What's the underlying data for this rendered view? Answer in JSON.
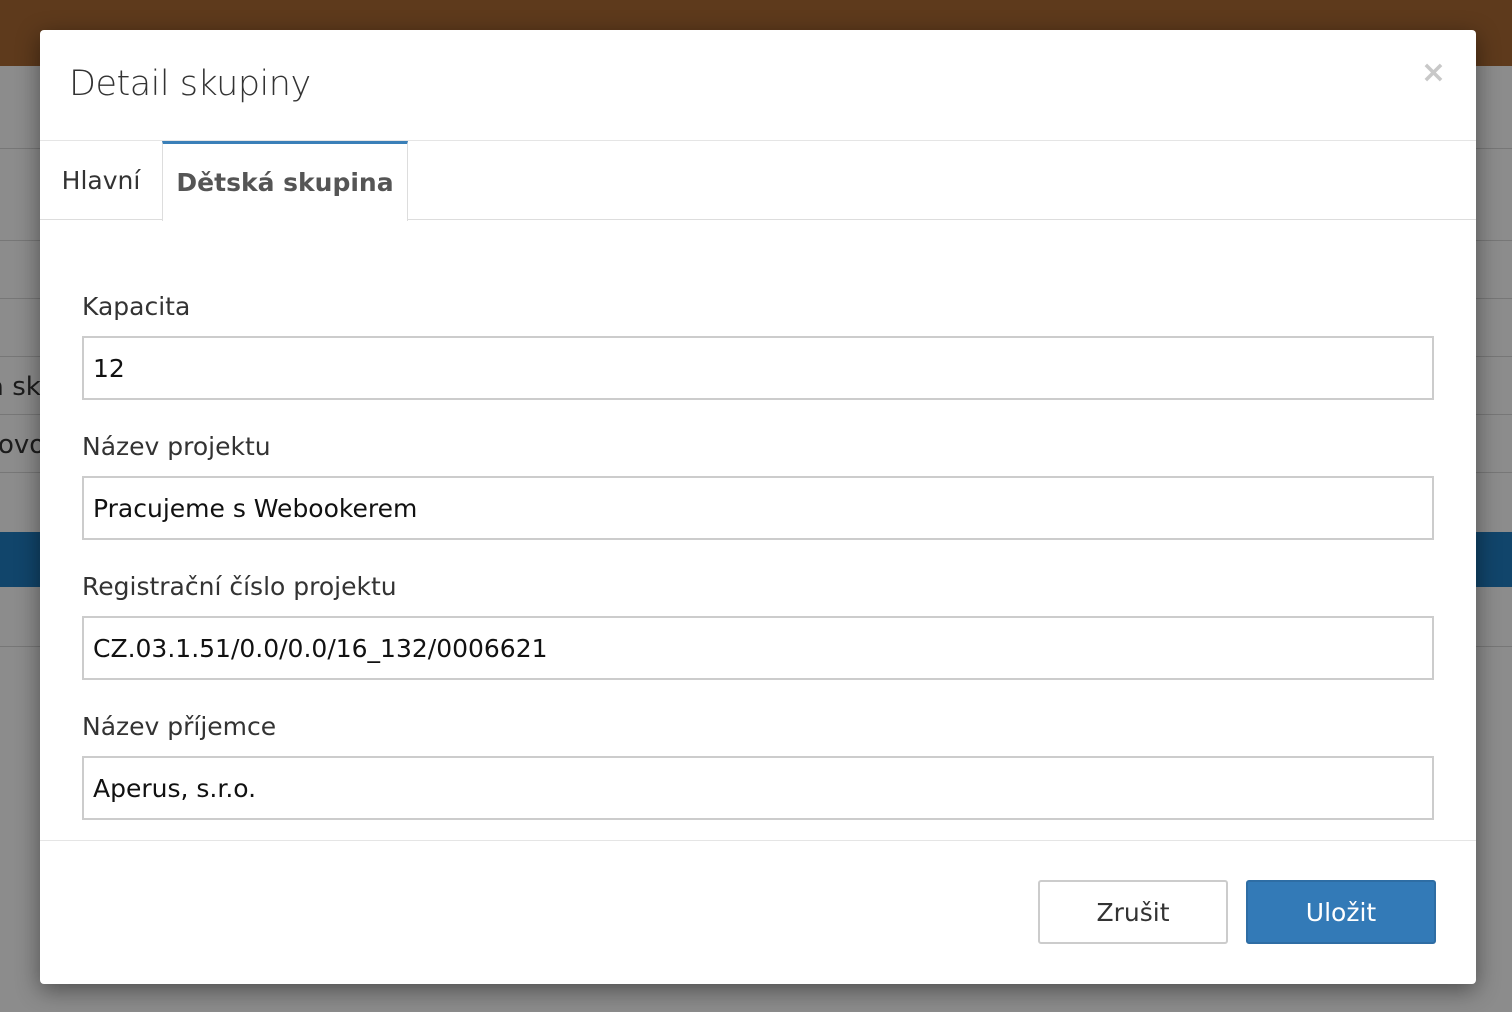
{
  "background": {
    "snippets": [
      "a sku",
      "ovo"
    ]
  },
  "modal": {
    "title": "Detail skupiny",
    "close_label": "×",
    "tabs": [
      {
        "label": "Hlavní",
        "active": false
      },
      {
        "label": "Dětská skupina",
        "active": true
      }
    ],
    "fields": [
      {
        "label": "Kapacita",
        "value": "12"
      },
      {
        "label": "Název projektu",
        "value": "Pracujeme s Webookerem"
      },
      {
        "label": "Registrační číslo projektu",
        "value": "CZ.03.1.51/0.0/0.0/16_132/0006621"
      },
      {
        "label": "Název příjemce",
        "value": "Aperus, s.r.o."
      }
    ],
    "footer": {
      "cancel_label": "Zrušit",
      "save_label": "Uložit"
    }
  },
  "colors": {
    "topbar": "#ac6a33",
    "active_tab_accent": "#3a7fb8",
    "primary_button": "#337ab7",
    "background_bar": "#1f7ec4"
  }
}
